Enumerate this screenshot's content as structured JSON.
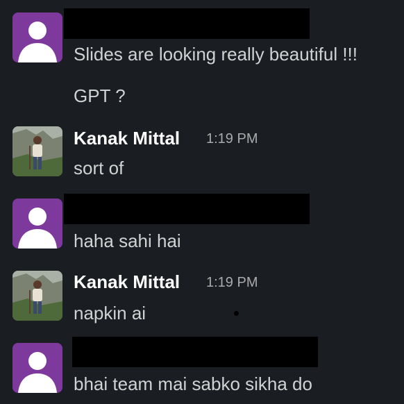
{
  "theme": {
    "background": "#1a1d21",
    "avatar_purple": "#7d3a9c",
    "name_color": "#ffffff",
    "time_color": "#ababad",
    "text_color": "#d1d2d3"
  },
  "messages": [
    {
      "sender": "",
      "avatar": "default-user-icon",
      "lines": [
        "Slides are looking really beautiful !!!",
        "GPT ?"
      ]
    },
    {
      "sender": "Kanak Mittal",
      "time": "1:19 PM",
      "avatar": "user-photo",
      "lines": [
        "sort of"
      ]
    },
    {
      "sender": "",
      "avatar": "default-user-icon",
      "lines": [
        "haha sahi hai"
      ]
    },
    {
      "sender": "Kanak Mittal",
      "time": "1:19 PM",
      "avatar": "user-photo",
      "lines": [
        "napkin ai"
      ]
    },
    {
      "sender": "",
      "avatar": "default-user-icon",
      "lines": [
        "bhai team mai sabko sikha do"
      ]
    }
  ]
}
